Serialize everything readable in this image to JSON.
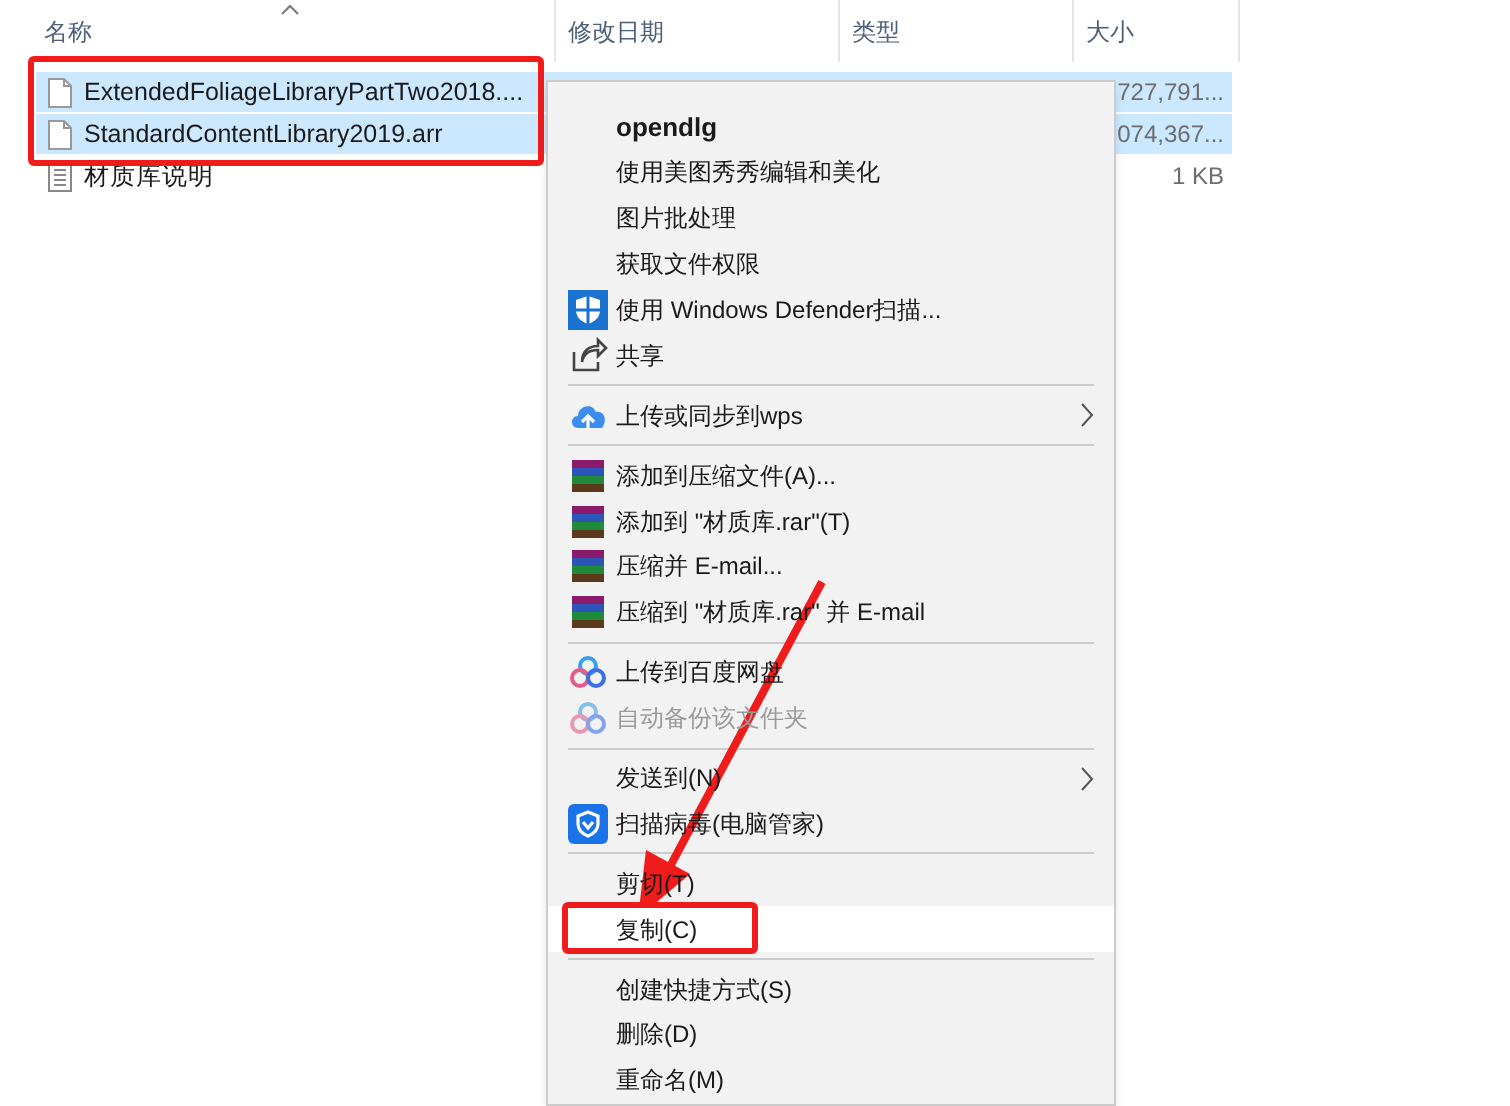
{
  "columns": [
    {
      "label": "名称",
      "sorted": true
    },
    {
      "label": "修改日期",
      "sorted": false
    },
    {
      "label": "类型",
      "sorted": false
    },
    {
      "label": "大小",
      "sorted": false
    }
  ],
  "files": [
    {
      "name": "ExtendedFoliageLibraryPartTwo2018....",
      "size": "727,791...",
      "selected": true,
      "kind": "file"
    },
    {
      "name": "StandardContentLibrary2019.arr",
      "size": "074,367...",
      "selected": true,
      "kind": "file"
    },
    {
      "name": "材质库说明",
      "size": "1 KB",
      "selected": false,
      "kind": "text"
    }
  ],
  "context_menu": {
    "items": [
      {
        "kind": "plain",
        "label": "opendlg",
        "bold": true
      },
      {
        "kind": "plain",
        "label": "使用美图秀秀编辑和美化"
      },
      {
        "kind": "plain",
        "label": "图片批处理"
      },
      {
        "kind": "plain",
        "label": "获取文件权限"
      },
      {
        "kind": "shield",
        "label": "使用 Windows Defender扫描..."
      },
      {
        "kind": "share",
        "label": "共享"
      },
      {
        "kind": "separator"
      },
      {
        "kind": "cloud",
        "label": "上传或同步到wps",
        "submenu": true
      },
      {
        "kind": "separator"
      },
      {
        "kind": "archive",
        "label": "添加到压缩文件(A)..."
      },
      {
        "kind": "archive",
        "label": "添加到 \"材质库.rar\"(T)"
      },
      {
        "kind": "archive",
        "label": "压缩并 E-mail..."
      },
      {
        "kind": "archive",
        "label": "压缩到 \"材质库.rar\" 并 E-mail"
      },
      {
        "kind": "separator"
      },
      {
        "kind": "rings",
        "label": "上传到百度网盘"
      },
      {
        "kind": "rings",
        "label": "自动备份该文件夹",
        "disabled": true
      },
      {
        "kind": "separator"
      },
      {
        "kind": "plain",
        "label": "发送到(N)",
        "submenu": true
      },
      {
        "kind": "guard",
        "label": "扫描病毒(电脑管家)"
      },
      {
        "kind": "separator"
      },
      {
        "kind": "plain",
        "label": "剪切(T)"
      },
      {
        "kind": "plain",
        "label": "复制(C)",
        "selected": true
      },
      {
        "kind": "separator"
      },
      {
        "kind": "plain",
        "label": "创建快捷方式(S)"
      },
      {
        "kind": "plain",
        "label": "删除(D)"
      },
      {
        "kind": "plain",
        "label": "重命名(M)"
      }
    ]
  }
}
